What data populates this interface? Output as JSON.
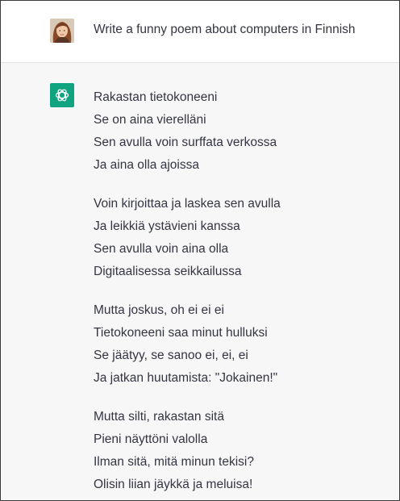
{
  "user_message": {
    "avatar": "user-avatar-photo",
    "text": "Write a funny poem about computers in Finnish"
  },
  "assistant_message": {
    "icon": "openai-logo-icon",
    "accent_color": "#10a37f",
    "stanzas": [
      [
        "Rakastan tietokoneeni",
        "Se on aina vierelläni",
        "Sen avulla voin surffata verkossa",
        "Ja aina olla ajoissa"
      ],
      [
        "Voin kirjoittaa ja laskea sen avulla",
        "Ja leikkiä ystävieni kanssa",
        "Sen avulla voin aina olla",
        "Digitaalisessa seikkailussa"
      ],
      [
        "Mutta joskus, oh ei ei ei",
        "Tietokoneeni saa minut hulluksi",
        "Se jäätyy, se sanoo ei, ei, ei",
        "Ja jatkan huutamista: \"Jokainen!\""
      ],
      [
        "Mutta silti, rakastan sitä",
        "Pieni näyttöni valolla",
        "Ilman sitä, mitä minun tekisi?",
        "Olisin liian jäykkä ja meluisa!"
      ]
    ]
  }
}
